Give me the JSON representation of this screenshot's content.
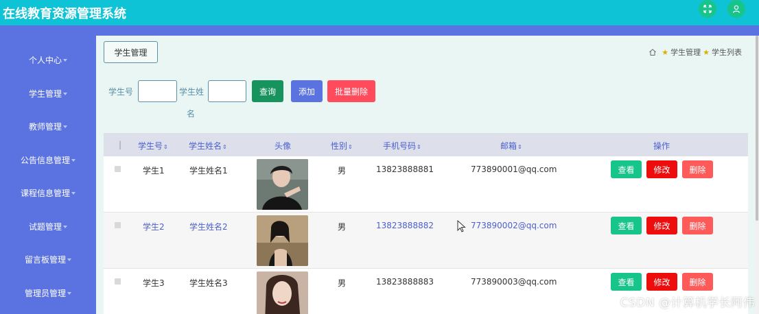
{
  "header": {
    "title": "在线教育资源管理系统",
    "icons": [
      "fullscreen-icon",
      "user-icon"
    ]
  },
  "sidebar": {
    "items": [
      {
        "label": "个人中心"
      },
      {
        "label": "学生管理"
      },
      {
        "label": "教师管理"
      },
      {
        "label": "公告信息管理"
      },
      {
        "label": "课程信息管理"
      },
      {
        "label": "试题管理"
      },
      {
        "label": "留言板管理"
      },
      {
        "label": "管理员管理"
      }
    ]
  },
  "page": {
    "section_title": "学生管理",
    "breadcrumb": [
      "学生管理",
      "学生列表"
    ]
  },
  "search": {
    "student_no_label": "学生号",
    "student_name_label_1": "学生姓",
    "student_name_label_2": "名",
    "query_button": "查询",
    "add_button": "添加",
    "batch_delete_button": "批量删除"
  },
  "table": {
    "headers": {
      "check": "|",
      "student_no": "学生号",
      "student_name": "学生姓名",
      "avatar": "头像",
      "gender": "性别",
      "phone": "手机号码",
      "email": "邮箱",
      "actions": "操作"
    },
    "sort_symbol": "⇕",
    "rows": [
      {
        "student_no": "学生1",
        "student_name": "学生姓名1",
        "gender": "男",
        "phone": "13823888881",
        "email": "773890001@qq.com"
      },
      {
        "student_no": "学生2",
        "student_name": "学生姓名2",
        "gender": "男",
        "phone": "13823888882",
        "email": "773890002@qq.com"
      },
      {
        "student_no": "学生3",
        "student_name": "学生姓名3",
        "gender": "男",
        "phone": "13823888883",
        "email": "773890003@qq.com"
      }
    ],
    "actions": {
      "view": "查看",
      "edit": "修改",
      "delete": "删除"
    }
  },
  "watermark": "CSDN @计算机学长阿伟",
  "colors": {
    "topbar": "#0fc3d6",
    "sidebar": "#5b73e0",
    "query": "#17935e",
    "add": "#5b73e0",
    "batch_delete": "#ff4b5c",
    "view": "#17c48a",
    "edit": "#ee0d0d",
    "delete": "#ff5a5a"
  }
}
